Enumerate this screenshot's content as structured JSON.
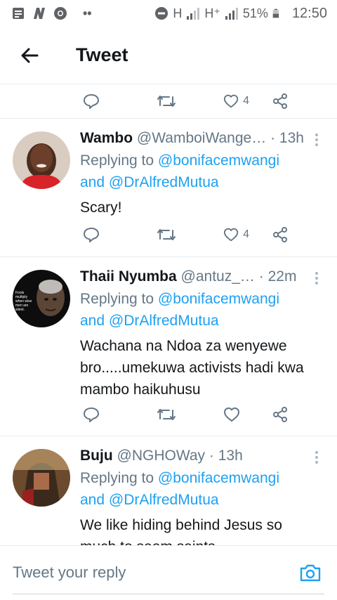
{
  "status_bar": {
    "battery": "51%",
    "time": "12:50",
    "net1": "H",
    "net2": "H⁺"
  },
  "header": {
    "title": "Tweet"
  },
  "top_actions": {
    "like_count": "4"
  },
  "tweets": [
    {
      "name": "Wambo",
      "handle": "@WamboiWange…",
      "time": "· 13h",
      "replying_prefix": "Replying to",
      "mention1": "@bonifacemwangi",
      "and": "and",
      "mention2": "@DrAlfredMutua",
      "text": "Scary!",
      "like_count": "4"
    },
    {
      "name": "Thaii Nyumba",
      "handle": "@antuz_…",
      "time": "· 22m",
      "replying_prefix": "Replying to",
      "mention1": "@bonifacemwangi",
      "and": "and",
      "mention2": "@DrAlfredMutua",
      "text": "Wachana na Ndoa za wenyewe bro.....umekuwa activists hadi kwa mambo haikuhusu",
      "like_count": "",
      "avatar_text": "Fools multiply when wise men are silent."
    },
    {
      "name": "Buju",
      "handle": "@NGHOWay",
      "time": "· 13h",
      "replying_prefix": "Replying to",
      "mention1": "@bonifacemwangi",
      "and": "and",
      "mention2": "@DrAlfredMutua",
      "text": "We like hiding behind Jesus so much to seem saints"
    }
  ],
  "composer": {
    "placeholder": "Tweet your reply"
  },
  "colors": {
    "accent": "#1da1f2",
    "muted": "#657786",
    "border": "#e6ecf0"
  }
}
